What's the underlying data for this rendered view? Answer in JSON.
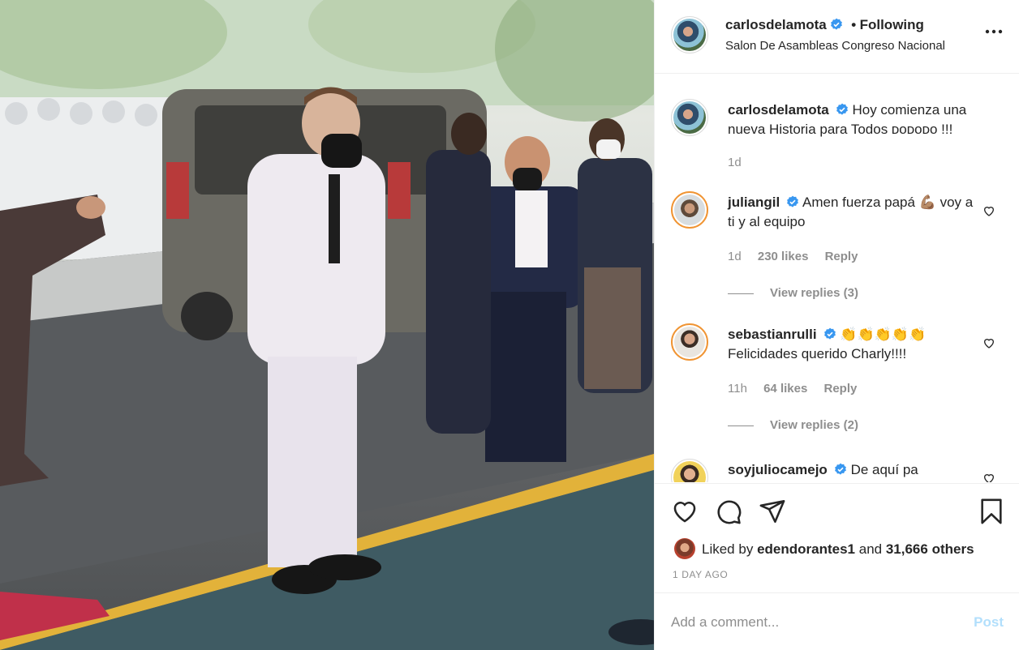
{
  "post": {
    "photo_alt": "",
    "author": {
      "username": "carlosdelamota",
      "verified": true,
      "follow_status": "Following",
      "location": "Salon De Asambleas Congreso Nacional"
    },
    "caption": {
      "username": "carlosdelamota",
      "text": "Hoy comienza una nueva Historia para Todos ᴅᴏᴅᴏᴅᴏ !!!",
      "time": "1d"
    },
    "comments": [
      {
        "username": "juliangil",
        "text": "Amen fuerza papá 💪🏽 voy a ti y al equipo",
        "time": "1d",
        "likes": "230 likes",
        "reply_label": "Reply",
        "view_replies": "View replies (3)"
      },
      {
        "username": "sebastianrulli",
        "text": "👏👏👏👏👏 Felicidades querido Charly!!!!",
        "time": "11h",
        "likes": "64 likes",
        "reply_label": "Reply",
        "view_replies": "View replies (2)"
      },
      {
        "username": "soyjuliocamejo",
        "text": "De aquí pa",
        "time": "",
        "likes": "",
        "reply_label": "",
        "view_replies": ""
      }
    ],
    "likes": {
      "prefix": "Liked by",
      "user": "edendorantes1",
      "conjunction": "and",
      "others": "31,666 others"
    },
    "time_ago": "1 DAY AGO",
    "add_comment": {
      "placeholder": "Add a comment...",
      "value": "",
      "post_label": "Post"
    }
  },
  "icons": {
    "more": "more-horizontal-icon",
    "verified": "verified-badge-icon",
    "like": "heart-icon",
    "comment": "comment-bubble-icon",
    "share": "paper-plane-icon",
    "save": "bookmark-icon"
  },
  "colors": {
    "verified": "#3897f0",
    "text": "#262626",
    "muted": "#8e8e8e",
    "post_disabled": "#b2dffc",
    "border": "#efefef"
  }
}
